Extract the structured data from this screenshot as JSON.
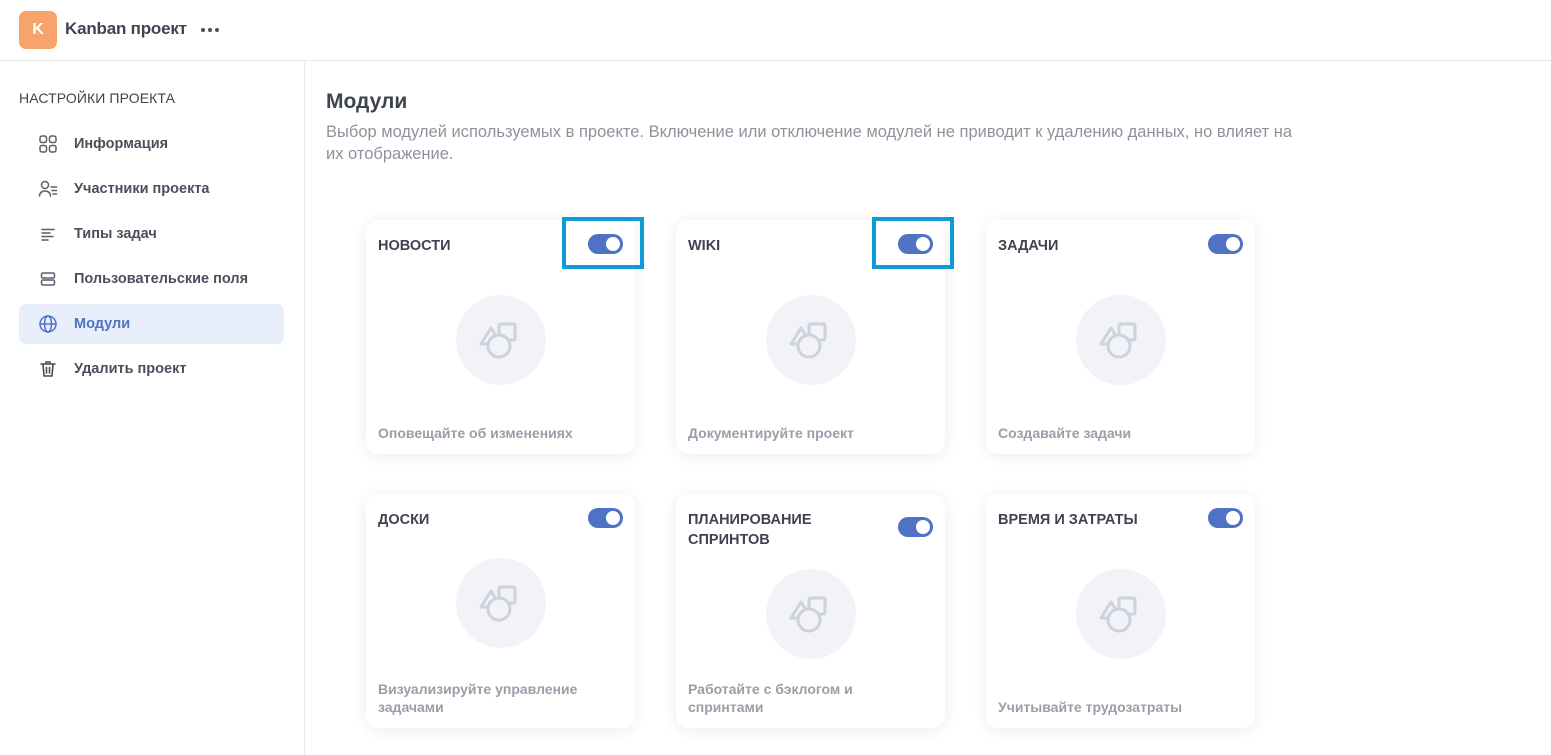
{
  "header": {
    "avatar_letter": "K",
    "avatar_color": "#f9a36c",
    "project_name": "Kanban проект",
    "more_icon": "more-horizontal-icon"
  },
  "sidebar": {
    "title": "НАСТРОЙКИ ПРОЕКТА",
    "items": [
      {
        "label": "Информация",
        "icon": "grid-icon",
        "active": false
      },
      {
        "label": "Участники проекта",
        "icon": "users-icon",
        "active": false
      },
      {
        "label": "Типы задач",
        "icon": "list-icon",
        "active": false
      },
      {
        "label": "Пользовательские поля",
        "icon": "fields-icon",
        "active": false
      },
      {
        "label": "Модули",
        "icon": "globe-icon",
        "active": true
      },
      {
        "label": "Удалить проект",
        "icon": "trash-icon",
        "active": false
      }
    ]
  },
  "main": {
    "title": "Модули",
    "description": "Выбор модулей используемых в проекте. Включение или отключение модулей не приводит к удалению данных, но влияет на их отображение.",
    "modules": [
      {
        "title": "НОВОСТИ",
        "description": "Оповещайте об изменениях",
        "enabled": true,
        "highlighted": true
      },
      {
        "title": "WIKI",
        "description": "Документируйте проект",
        "enabled": true,
        "highlighted": true
      },
      {
        "title": "ЗАДАЧИ",
        "description": "Создавайте задачи",
        "enabled": true,
        "highlighted": false
      },
      {
        "title": "ДОСКИ",
        "description": "Визуализируйте управление задачами",
        "enabled": true,
        "highlighted": false
      },
      {
        "title": "ПЛАНИРОВАНИЕ СПРИНТОВ",
        "description": "Работайте с бэклогом и спринтами",
        "enabled": true,
        "highlighted": false
      },
      {
        "title": "ВРЕМЯ И ЗАТРАТЫ",
        "description": "Учитывайте трудозатраты",
        "enabled": true,
        "highlighted": false
      }
    ]
  },
  "colors": {
    "accent": "#4f72c4",
    "highlight": "#0f9ad8",
    "active_bg": "#e9effa"
  }
}
